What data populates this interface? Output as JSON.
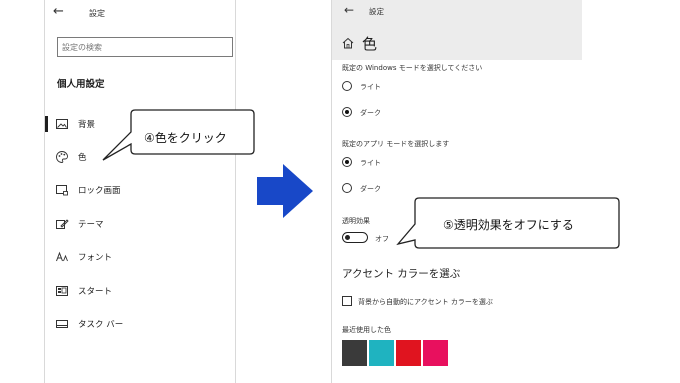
{
  "left_panel": {
    "back_glyph": "←",
    "title": "設定",
    "search_placeholder": "設定の検索",
    "section_title": "個人用設定",
    "nav_items": [
      {
        "label": "背景",
        "icon": "picture-icon"
      },
      {
        "label": "色",
        "icon": "palette-icon"
      },
      {
        "label": "ロック画面",
        "icon": "lock-screen-icon"
      },
      {
        "label": "テーマ",
        "icon": "theme-icon"
      },
      {
        "label": "フォント",
        "icon": "font-icon"
      },
      {
        "label": "スタート",
        "icon": "start-icon"
      },
      {
        "label": "タスク バー",
        "icon": "taskbar-icon"
      }
    ]
  },
  "right_panel": {
    "back_glyph": "←",
    "title": "設定",
    "heading": "色",
    "windows_mode": {
      "caption": "既定の Windows モードを選択してください",
      "options": [
        {
          "label": "ライト",
          "selected": false
        },
        {
          "label": "ダーク",
          "selected": true
        }
      ]
    },
    "app_mode": {
      "caption": "既定のアプリ モードを選択します",
      "options": [
        {
          "label": "ライト",
          "selected": true
        },
        {
          "label": "ダーク",
          "selected": false
        }
      ]
    },
    "transparency": {
      "caption": "透明効果",
      "state_label": "オフ"
    },
    "accent_heading": "アクセント カラーを選ぶ",
    "auto_accent_label": "背景から自動的にアクセント カラーを選ぶ",
    "recent_colors_caption": "最近使用した色",
    "recent_colors": [
      "#3a3a3a",
      "#1fb3c0",
      "#e0141f",
      "#e8105e"
    ]
  },
  "callouts": {
    "step4": "④色をクリック",
    "step5": "⑤透明効果をオフにする"
  },
  "colors": {
    "arrow": "#1848c8",
    "top_bar": "#ececec"
  }
}
